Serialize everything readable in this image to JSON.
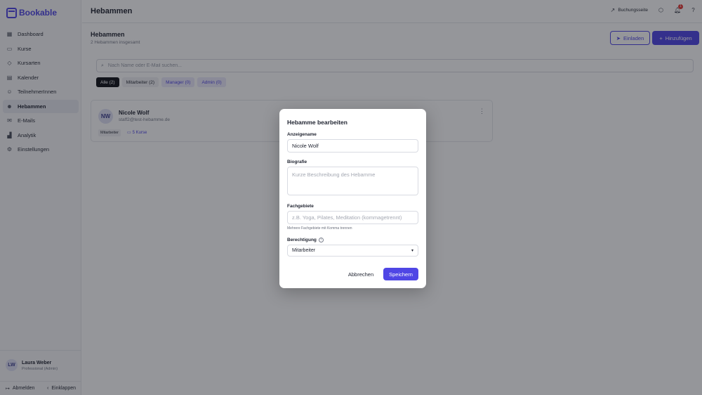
{
  "brand": {
    "name": "Bookable"
  },
  "sidebar": {
    "items": [
      {
        "label": "Dashboard",
        "icon": "grid-icon"
      },
      {
        "label": "Kurse",
        "icon": "book-icon"
      },
      {
        "label": "Kursarten",
        "icon": "tag-icon"
      },
      {
        "label": "Kalender",
        "icon": "calendar-icon"
      },
      {
        "label": "TeilnehmerInnen",
        "icon": "users-icon"
      },
      {
        "label": "Hebammen",
        "icon": "user-cog-icon",
        "active": true
      },
      {
        "label": "E-Mails",
        "icon": "mail-icon"
      },
      {
        "label": "Analytik",
        "icon": "chart-icon"
      },
      {
        "label": "Einstellungen",
        "icon": "gear-icon"
      }
    ],
    "user": {
      "initials": "LW",
      "name": "Laura Weber",
      "role": "Professional (Admin)"
    },
    "footer": {
      "logout": "Abmelden",
      "collapse": "Einklappen"
    }
  },
  "topbar": {
    "title": "Hebammen",
    "booking_link": "Buchungsseite",
    "notification_count": "1"
  },
  "page": {
    "title": "Hebammen",
    "subtitle": "2 Hebammen insgesamt",
    "invite_label": "Einladen",
    "add_label": "Hinzufügen",
    "search_placeholder": "Nach Name oder E-Mail suchen...",
    "filters": [
      {
        "label": "Alle (2)"
      },
      {
        "label": "Mitarbeiter (2)"
      },
      {
        "label": "Manager (0)"
      },
      {
        "label": "Admin (0)"
      }
    ]
  },
  "card": {
    "initials": "NW",
    "name": "Nicole Wolf",
    "email": "staff2@test-hebamme.de",
    "role": "Mitarbeiter",
    "courses": "5 Kurse"
  },
  "modal": {
    "title": "Hebamme bearbeiten",
    "display_name_label": "Anzeigename",
    "display_name_value": "Nicole Wolf",
    "bio_label": "Biografie",
    "bio_placeholder": "Kurze Beschreibung des Hebamme",
    "specialties_label": "Fachgebiete",
    "specialties_placeholder": "z.B. Yoga, Pilates, Meditation (kommagetrennt)",
    "specialties_help": "Mehrere Fachgebiete mit Komma trennen",
    "permission_label": "Berechtigung",
    "permission_value": "Mitarbeiter",
    "cancel_label": "Abbrechen",
    "save_label": "Speichern"
  },
  "colors": {
    "accent": "#4f46e5",
    "badge": "#e53935"
  }
}
